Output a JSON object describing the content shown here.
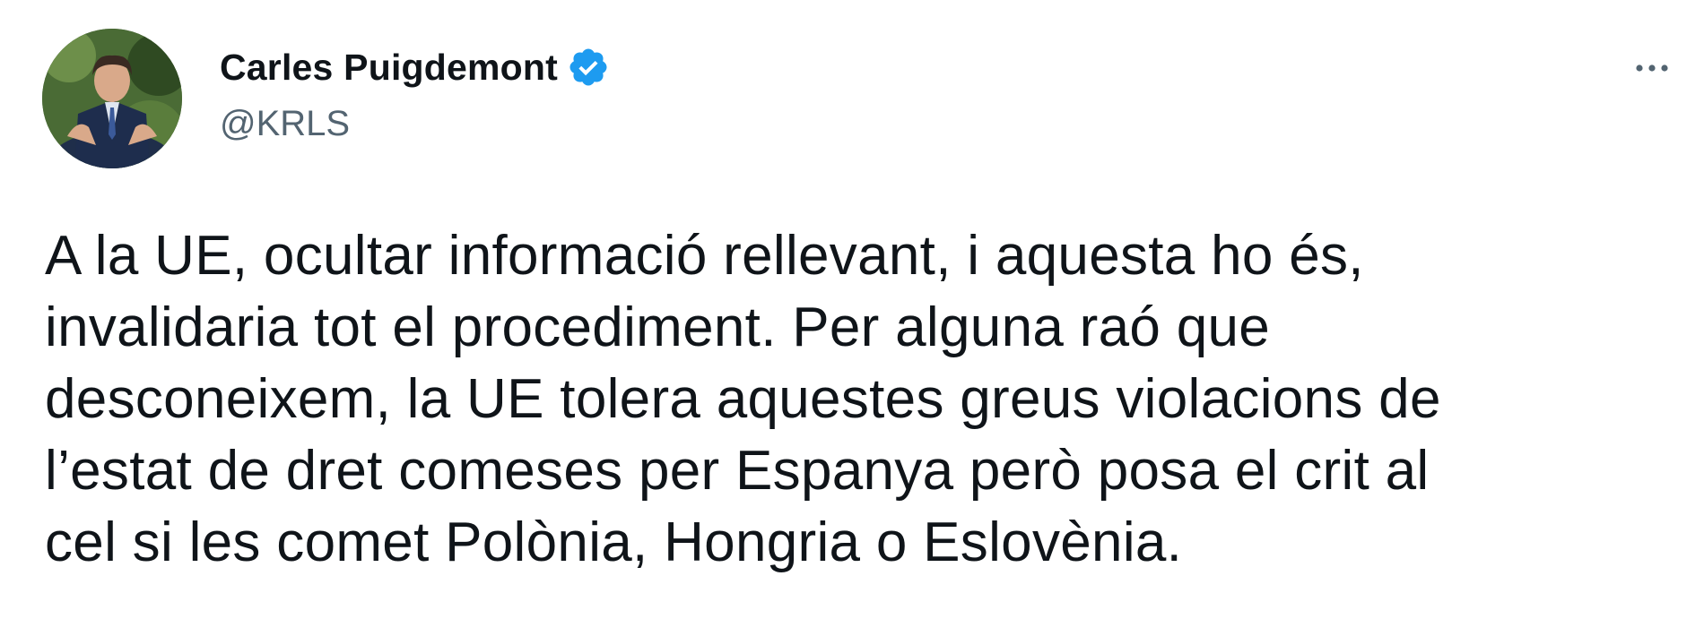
{
  "author": {
    "display_name": "Carles Puigdemont",
    "handle": "@KRLS",
    "verified": true,
    "avatar_icon": "profile-photo",
    "verified_icon": "verified-badge-icon"
  },
  "menu": {
    "icon": "more-options-icon"
  },
  "tweet": {
    "lines": [
      "A la UE, ocultar informació rellevant, i aquesta ho és,",
      "invalidaria tot el procediment. Per alguna raó que",
      "desconeixem, la UE tolera aquestes greus violacions de",
      "l’estat de dret comeses per Espanya però posa el crit al",
      "cel si les comet Polònia, Hongria o Eslovènia."
    ]
  },
  "colors": {
    "verified_blue": "#1d9bf0",
    "secondary_text": "#536471",
    "primary_text": "#0f1419"
  }
}
